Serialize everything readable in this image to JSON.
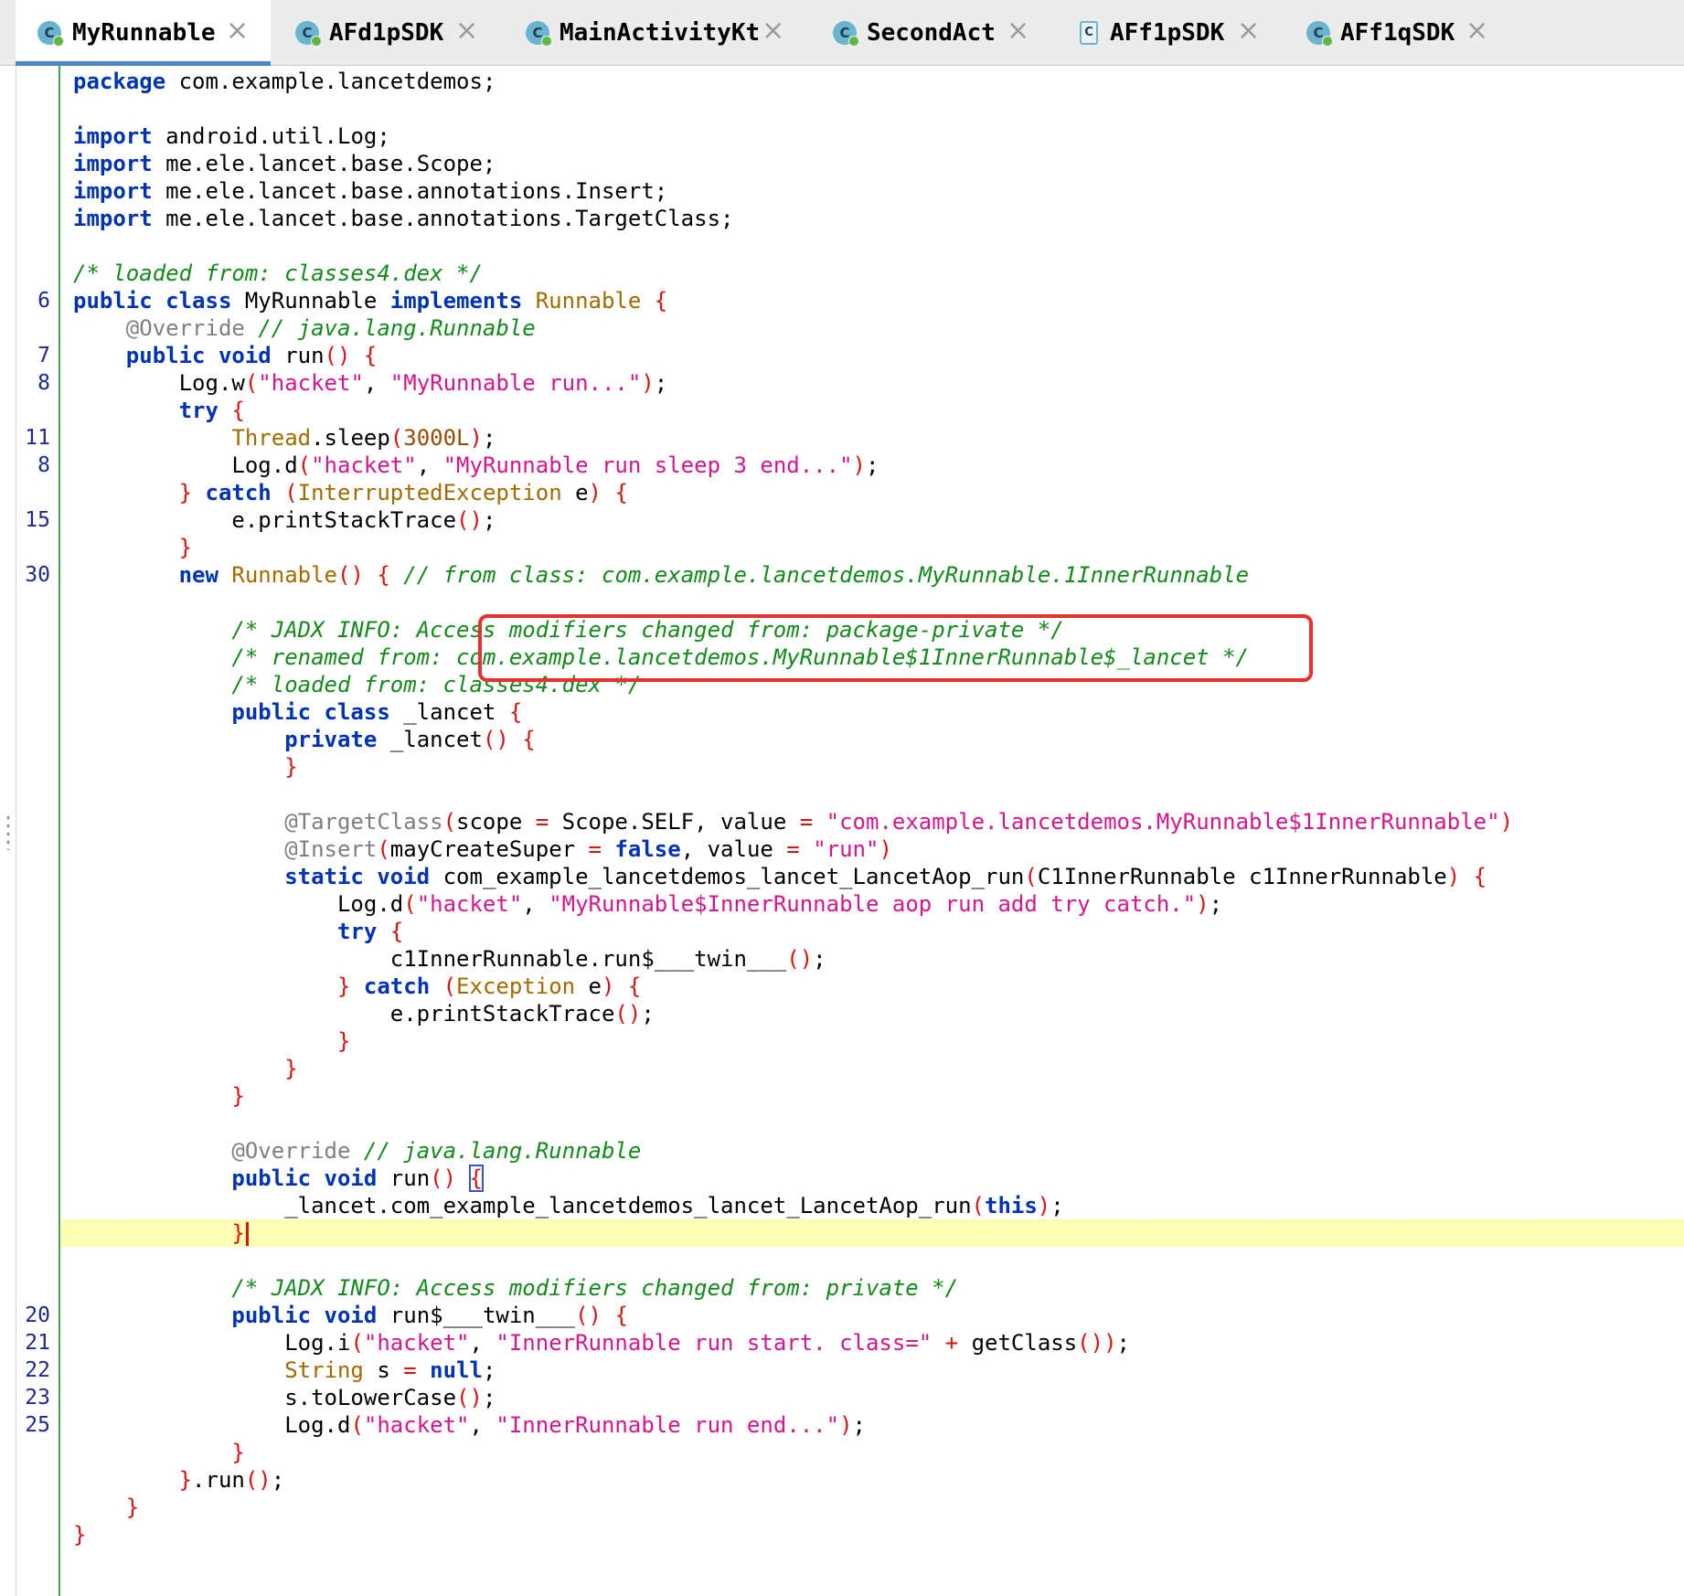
{
  "tabs": [
    {
      "label": "MyRunnable",
      "icon": "java-class-icon",
      "active": true
    },
    {
      "label": "AFd1pSDK",
      "icon": "java-class-icon",
      "active": false
    },
    {
      "label": "MainActivityKt",
      "icon": "java-class-icon",
      "active": false
    },
    {
      "label": "SecondAct",
      "icon": "java-class-icon",
      "active": false
    },
    {
      "label": "AFf1pSDK",
      "icon": "java-file-icon",
      "active": false
    },
    {
      "label": "AFf1qSDK",
      "icon": "java-class-icon",
      "active": false
    }
  ],
  "tab_close_glyph": "×",
  "tab_icon_letter": "C",
  "colors": {
    "keyword": "#0033b3",
    "string": "#d8158a",
    "comment": "#138a1b",
    "type": "#a36a00",
    "annotation": "#7f7f7f",
    "brace": "#dd1111",
    "line_number": "#1e2a8f",
    "gutter_border": "#46a447",
    "current_line": "#fdfdb4",
    "highlight_box": "#e5322d",
    "active_tab_underline": "#4a88c7"
  },
  "editor": {
    "lines": [
      {
        "num": "",
        "tokens": [
          [
            "kw",
            "package"
          ],
          [
            "pl",
            " com.example.lancetdemos;"
          ]
        ]
      },
      {
        "num": "",
        "tokens": []
      },
      {
        "num": "",
        "tokens": [
          [
            "kw",
            "import"
          ],
          [
            "pl",
            " android.util.Log;"
          ]
        ]
      },
      {
        "num": "",
        "tokens": [
          [
            "kw",
            "import"
          ],
          [
            "pl",
            " me.ele.lancet.base.Scope;"
          ]
        ]
      },
      {
        "num": "",
        "tokens": [
          [
            "kw",
            "import"
          ],
          [
            "pl",
            " me.ele.lancet.base.annotations.Insert;"
          ]
        ]
      },
      {
        "num": "",
        "tokens": [
          [
            "kw",
            "import"
          ],
          [
            "pl",
            " me.ele.lancet.base.annotations.TargetClass;"
          ]
        ]
      },
      {
        "num": "",
        "tokens": []
      },
      {
        "num": "",
        "tokens": [
          [
            "cm",
            "/* loaded from: classes4.dex */"
          ]
        ]
      },
      {
        "num": "6",
        "tokens": [
          [
            "kw",
            "public class"
          ],
          [
            "pl",
            " MyRunnable "
          ],
          [
            "kw",
            "implements"
          ],
          [
            "pl",
            " "
          ],
          [
            "ty",
            "Runnable"
          ],
          [
            "pl",
            " "
          ],
          [
            "op",
            "{"
          ]
        ]
      },
      {
        "num": "",
        "tokens": [
          [
            "pl",
            "    "
          ],
          [
            "an",
            "@Override"
          ],
          [
            "pl",
            " "
          ],
          [
            "cm",
            "// java.lang.Runnable"
          ]
        ]
      },
      {
        "num": "7",
        "tokens": [
          [
            "pl",
            "    "
          ],
          [
            "kw",
            "public void"
          ],
          [
            "pl",
            " run"
          ],
          [
            "op",
            "()"
          ],
          [
            "pl",
            " "
          ],
          [
            "op",
            "{"
          ]
        ]
      },
      {
        "num": "8",
        "tokens": [
          [
            "pl",
            "        Log.w"
          ],
          [
            "op",
            "("
          ],
          [
            "str",
            "\"hacket\""
          ],
          [
            "pl",
            ", "
          ],
          [
            "str",
            "\"MyRunnable run...\""
          ],
          [
            "op",
            ")"
          ],
          [
            "pl",
            ";"
          ]
        ]
      },
      {
        "num": "",
        "tokens": [
          [
            "pl",
            "        "
          ],
          [
            "kw",
            "try"
          ],
          [
            "pl",
            " "
          ],
          [
            "op",
            "{"
          ]
        ]
      },
      {
        "num": "11",
        "tokens": [
          [
            "pl",
            "            "
          ],
          [
            "ty",
            "Thread"
          ],
          [
            "pl",
            ".sleep"
          ],
          [
            "op",
            "("
          ],
          [
            "num",
            "3000L"
          ],
          [
            "op",
            ")"
          ],
          [
            "pl",
            ";"
          ]
        ]
      },
      {
        "num": "8",
        "tokens": [
          [
            "pl",
            "            Log.d"
          ],
          [
            "op",
            "("
          ],
          [
            "str",
            "\"hacket\""
          ],
          [
            "pl",
            ", "
          ],
          [
            "str",
            "\"MyRunnable run sleep 3 end...\""
          ],
          [
            "op",
            ")"
          ],
          [
            "pl",
            ";"
          ]
        ]
      },
      {
        "num": "",
        "tokens": [
          [
            "pl",
            "        "
          ],
          [
            "op",
            "}"
          ],
          [
            "pl",
            " "
          ],
          [
            "kw",
            "catch"
          ],
          [
            "pl",
            " "
          ],
          [
            "op",
            "("
          ],
          [
            "ty",
            "InterruptedException"
          ],
          [
            "pl",
            " e"
          ],
          [
            "op",
            ")"
          ],
          [
            "pl",
            " "
          ],
          [
            "op",
            "{"
          ]
        ]
      },
      {
        "num": "15",
        "tokens": [
          [
            "pl",
            "            e.printStackTrace"
          ],
          [
            "op",
            "()"
          ],
          [
            "pl",
            ";"
          ]
        ]
      },
      {
        "num": "",
        "tokens": [
          [
            "pl",
            "        "
          ],
          [
            "op",
            "}"
          ]
        ]
      },
      {
        "num": "30",
        "tokens": [
          [
            "pl",
            "        "
          ],
          [
            "kw",
            "new"
          ],
          [
            "pl",
            " "
          ],
          [
            "ty",
            "Runnable"
          ],
          [
            "op",
            "()"
          ],
          [
            "pl",
            " "
          ],
          [
            "op",
            "{"
          ],
          [
            "pl",
            " "
          ],
          [
            "cm",
            "// from class: com.example.lancetdemos.MyRunnable.1InnerRunnable"
          ]
        ]
      },
      {
        "num": "",
        "tokens": []
      },
      {
        "num": "",
        "tokens": [
          [
            "pl",
            "            "
          ],
          [
            "cm",
            "/* JADX INFO: Access modifiers changed from: package-private */"
          ]
        ]
      },
      {
        "num": "",
        "tokens": [
          [
            "pl",
            "            "
          ],
          [
            "cm",
            "/* renamed from: com.example.lancetdemos.MyRunnable$1InnerRunnable$_lancet */"
          ]
        ]
      },
      {
        "num": "",
        "tokens": [
          [
            "pl",
            "            "
          ],
          [
            "cm",
            "/* loaded from: classes4.dex */"
          ]
        ]
      },
      {
        "num": "",
        "tokens": [
          [
            "pl",
            "            "
          ],
          [
            "kw",
            "public class"
          ],
          [
            "pl",
            " _lancet "
          ],
          [
            "op",
            "{"
          ]
        ]
      },
      {
        "num": "",
        "tokens": [
          [
            "pl",
            "                "
          ],
          [
            "kw",
            "private"
          ],
          [
            "pl",
            " _lancet"
          ],
          [
            "op",
            "()"
          ],
          [
            "pl",
            " "
          ],
          [
            "op",
            "{"
          ]
        ]
      },
      {
        "num": "",
        "tokens": [
          [
            "pl",
            "                "
          ],
          [
            "op",
            "}"
          ]
        ]
      },
      {
        "num": "",
        "tokens": []
      },
      {
        "num": "",
        "tokens": [
          [
            "pl",
            "                "
          ],
          [
            "an",
            "@TargetClass"
          ],
          [
            "op",
            "("
          ],
          [
            "pl",
            "scope "
          ],
          [
            "op",
            "="
          ],
          [
            "pl",
            " Scope.SELF, value "
          ],
          [
            "op",
            "="
          ],
          [
            "pl",
            " "
          ],
          [
            "str",
            "\"com.example.lancetdemos.MyRunnable$1InnerRunnable\""
          ],
          [
            "op",
            ")"
          ]
        ]
      },
      {
        "num": "",
        "tokens": [
          [
            "pl",
            "                "
          ],
          [
            "an",
            "@Insert"
          ],
          [
            "op",
            "("
          ],
          [
            "pl",
            "mayCreateSuper "
          ],
          [
            "op",
            "="
          ],
          [
            "pl",
            " "
          ],
          [
            "kw",
            "false"
          ],
          [
            "pl",
            ", value "
          ],
          [
            "op",
            "="
          ],
          [
            "pl",
            " "
          ],
          [
            "str",
            "\"run\""
          ],
          [
            "op",
            ")"
          ]
        ]
      },
      {
        "num": "",
        "tokens": [
          [
            "pl",
            "                "
          ],
          [
            "kw",
            "static void"
          ],
          [
            "pl",
            " com_example_lancetdemos_lancet_LancetAop_run"
          ],
          [
            "op",
            "("
          ],
          [
            "pl",
            "C1InnerRunnable c1InnerRunnable"
          ],
          [
            "op",
            ")"
          ],
          [
            "pl",
            " "
          ],
          [
            "op",
            "{"
          ]
        ]
      },
      {
        "num": "",
        "tokens": [
          [
            "pl",
            "                    Log.d"
          ],
          [
            "op",
            "("
          ],
          [
            "str",
            "\"hacket\""
          ],
          [
            "pl",
            ", "
          ],
          [
            "str",
            "\"MyRunnable$InnerRunnable aop run add try catch.\""
          ],
          [
            "op",
            ")"
          ],
          [
            "pl",
            ";"
          ]
        ]
      },
      {
        "num": "",
        "tokens": [
          [
            "pl",
            "                    "
          ],
          [
            "kw",
            "try"
          ],
          [
            "pl",
            " "
          ],
          [
            "op",
            "{"
          ]
        ]
      },
      {
        "num": "",
        "tokens": [
          [
            "pl",
            "                        c1InnerRunnable.run$___twin___"
          ],
          [
            "op",
            "()"
          ],
          [
            "pl",
            ";"
          ]
        ]
      },
      {
        "num": "",
        "tokens": [
          [
            "pl",
            "                    "
          ],
          [
            "op",
            "}"
          ],
          [
            "pl",
            " "
          ],
          [
            "kw",
            "catch"
          ],
          [
            "pl",
            " "
          ],
          [
            "op",
            "("
          ],
          [
            "ty",
            "Exception"
          ],
          [
            "pl",
            " e"
          ],
          [
            "op",
            ")"
          ],
          [
            "pl",
            " "
          ],
          [
            "op",
            "{"
          ]
        ]
      },
      {
        "num": "",
        "tokens": [
          [
            "pl",
            "                        e.printStackTrace"
          ],
          [
            "op",
            "()"
          ],
          [
            "pl",
            ";"
          ]
        ]
      },
      {
        "num": "",
        "tokens": [
          [
            "pl",
            "                    "
          ],
          [
            "op",
            "}"
          ]
        ]
      },
      {
        "num": "",
        "tokens": [
          [
            "pl",
            "                "
          ],
          [
            "op",
            "}"
          ]
        ]
      },
      {
        "num": "",
        "tokens": [
          [
            "pl",
            "            "
          ],
          [
            "op",
            "}"
          ]
        ]
      },
      {
        "num": "",
        "tokens": []
      },
      {
        "num": "",
        "tokens": [
          [
            "pl",
            "            "
          ],
          [
            "an",
            "@Override"
          ],
          [
            "pl",
            " "
          ],
          [
            "cm",
            "// java.lang.Runnable"
          ]
        ]
      },
      {
        "num": "",
        "tokens": [
          [
            "pl",
            "            "
          ],
          [
            "kw",
            "public void"
          ],
          [
            "pl",
            " run"
          ],
          [
            "op",
            "()"
          ],
          [
            "pl",
            " "
          ],
          [
            "match",
            "{"
          ]
        ]
      },
      {
        "num": "",
        "tokens": [
          [
            "pl",
            "                _lancet.com_example_lancetdemos_lancet_LancetAop_run"
          ],
          [
            "op",
            "("
          ],
          [
            "kw",
            "this"
          ],
          [
            "op",
            ")"
          ],
          [
            "pl",
            ";"
          ]
        ]
      },
      {
        "num": "",
        "current": true,
        "tokens": [
          [
            "pl",
            "            "
          ],
          [
            "op",
            "}"
          ],
          [
            "caret",
            ""
          ]
        ]
      },
      {
        "num": "",
        "tokens": []
      },
      {
        "num": "",
        "tokens": [
          [
            "pl",
            "            "
          ],
          [
            "cm",
            "/* JADX INFO: Access modifiers changed from: private */"
          ]
        ]
      },
      {
        "num": "20",
        "tokens": [
          [
            "pl",
            "            "
          ],
          [
            "kw",
            "public void"
          ],
          [
            "pl",
            " run$___twin___"
          ],
          [
            "op",
            "()"
          ],
          [
            "pl",
            " "
          ],
          [
            "op",
            "{"
          ]
        ]
      },
      {
        "num": "21",
        "tokens": [
          [
            "pl",
            "                Log.i"
          ],
          [
            "op",
            "("
          ],
          [
            "str",
            "\"hacket\""
          ],
          [
            "pl",
            ", "
          ],
          [
            "str",
            "\"InnerRunnable run start. class=\""
          ],
          [
            "pl",
            " "
          ],
          [
            "op",
            "+"
          ],
          [
            "pl",
            " getClass"
          ],
          [
            "op",
            "())"
          ],
          [
            "pl",
            ";"
          ]
        ]
      },
      {
        "num": "22",
        "tokens": [
          [
            "pl",
            "                "
          ],
          [
            "ty",
            "String"
          ],
          [
            "pl",
            " s "
          ],
          [
            "op",
            "="
          ],
          [
            "pl",
            " "
          ],
          [
            "kw",
            "null"
          ],
          [
            "pl",
            ";"
          ]
        ]
      },
      {
        "num": "23",
        "tokens": [
          [
            "pl",
            "                s.toLowerCase"
          ],
          [
            "op",
            "()"
          ],
          [
            "pl",
            ";"
          ]
        ]
      },
      {
        "num": "25",
        "tokens": [
          [
            "pl",
            "                Log.d"
          ],
          [
            "op",
            "("
          ],
          [
            "str",
            "\"hacket\""
          ],
          [
            "pl",
            ", "
          ],
          [
            "str",
            "\"InnerRunnable run end...\""
          ],
          [
            "op",
            ")"
          ],
          [
            "pl",
            ";"
          ]
        ]
      },
      {
        "num": "",
        "tokens": [
          [
            "pl",
            "            "
          ],
          [
            "op",
            "}"
          ]
        ]
      },
      {
        "num": "",
        "tokens": [
          [
            "pl",
            "        "
          ],
          [
            "op",
            "}"
          ],
          [
            "pl",
            ".run"
          ],
          [
            "op",
            "()"
          ],
          [
            "pl",
            ";"
          ]
        ]
      },
      {
        "num": "",
        "tokens": [
          [
            "pl",
            "    "
          ],
          [
            "op",
            "}"
          ]
        ]
      },
      {
        "num": "",
        "tokens": [
          [
            "op",
            "}"
          ]
        ]
      }
    ]
  }
}
